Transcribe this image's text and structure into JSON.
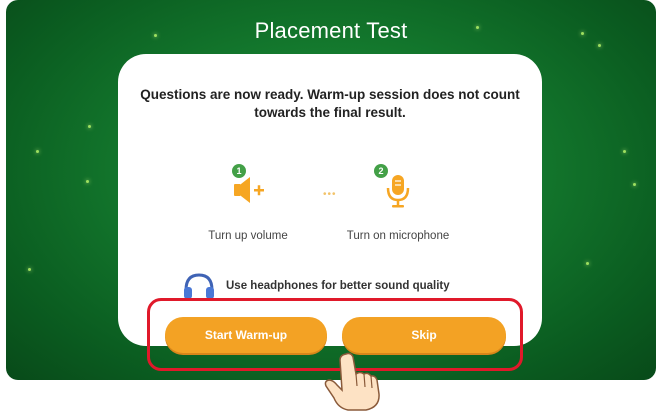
{
  "header": {
    "title": "Placement Test"
  },
  "card": {
    "message": "Questions are now ready. Warm-up session does not count towards the final result.",
    "steps": [
      {
        "number": "1",
        "label": "Turn up volume",
        "icon": "speaker-volume-icon"
      },
      {
        "number": "2",
        "label": "Turn on microphone",
        "icon": "microphone-icon"
      }
    ],
    "headphones_tip": "Use headphones for better sound quality"
  },
  "actions": {
    "start_label": "Start Warm-up",
    "skip_label": "Skip"
  },
  "colors": {
    "background": "#147a2e",
    "accent": "#f3a224",
    "highlight": "#e0192a",
    "step_badge": "#43a047"
  }
}
